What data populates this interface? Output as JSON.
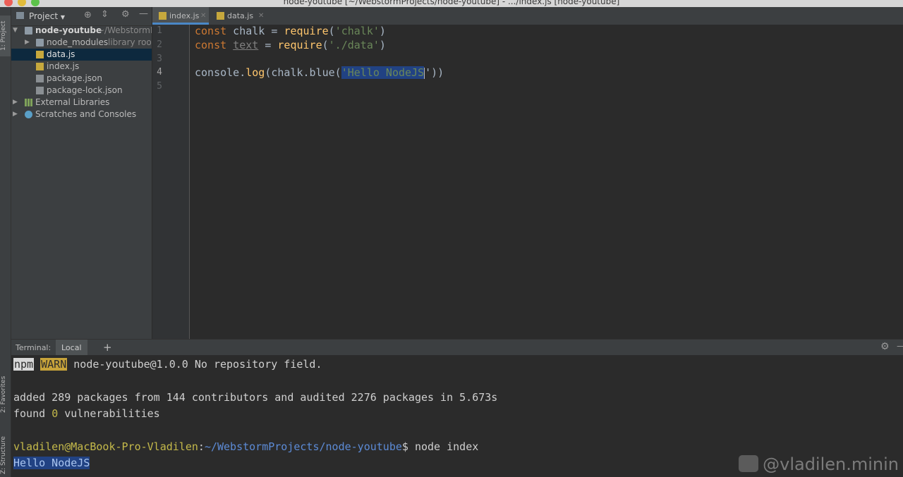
{
  "window": {
    "title": "node-youtube [~/WebstormProjects/node-youtube] - .../index.js [node-youtube]"
  },
  "left_strip": {
    "project_tab": "1: Project",
    "favorites_tab": "2: Favorites",
    "structure_tab": "Z: Structure"
  },
  "project_panel": {
    "header_label": "Project",
    "tree": [
      {
        "label": "node-youtube",
        "suffix": "~/WebstormP",
        "icon": "folder-icon",
        "expanded": true
      },
      {
        "label": "node_modules",
        "suffix": "library root",
        "icon": "folder-icon",
        "expanded": false
      },
      {
        "label": "data.js",
        "suffix": "",
        "icon": "js-file-icon",
        "selected": true
      },
      {
        "label": "index.js",
        "suffix": "",
        "icon": "js-file-icon"
      },
      {
        "label": "package.json",
        "suffix": "",
        "icon": "json-file-icon"
      },
      {
        "label": "package-lock.json",
        "suffix": "",
        "icon": "json-file-icon"
      },
      {
        "label": "External Libraries",
        "suffix": "",
        "icon": "library-icon"
      },
      {
        "label": "Scratches and Consoles",
        "suffix": "",
        "icon": "scratches-icon"
      }
    ]
  },
  "editor": {
    "tabs": [
      {
        "label": "index.js",
        "active": true
      },
      {
        "label": "data.js",
        "active": false
      }
    ],
    "line_numbers": [
      "1",
      "2",
      "3",
      "4",
      "5"
    ],
    "current_line": "4",
    "lines": {
      "l1": {
        "kw": "const",
        "var": " chalk = ",
        "fn": "require",
        "open": "(",
        "str": "'chalk'",
        "close": ")"
      },
      "l2": {
        "kw": "const",
        "sp": " ",
        "var": "text",
        "eq": " = ",
        "fn": "require",
        "open": "(",
        "str": "'./data'",
        "close": ")"
      },
      "l4": {
        "pre": "console.",
        "fn": "log",
        "mid": "(chalk.blue(",
        "str": "'Hello NodeJS",
        "end": "'))"
      }
    }
  },
  "terminal": {
    "label": "Terminal:",
    "tab": "Local",
    "add": "+",
    "lines": {
      "warn": {
        "npm": "npm",
        "warn": "WARN",
        "text": " node-youtube@1.0.0 No repository field."
      },
      "added": "added 289 packages from 144 contributors and audited 2276 packages in 5.673s",
      "found": {
        "pre": "found ",
        "num": "0",
        "post": " vulnerabilities"
      },
      "prompt": {
        "user": "vladilen@",
        "host": "MacBook-Pro-Vladilen",
        "colon": ":",
        "path": "~/WebstormProjects/node-youtube",
        "cmd": "$ node index"
      },
      "output": "Hello NodeJS"
    }
  },
  "watermark": "@vladilen.minin",
  "colors": {
    "keyword": "#cc7832",
    "function": "#ffc66d",
    "string": "#6a8759",
    "selection": "#214283",
    "terminal_path": "#5c8bd6"
  }
}
